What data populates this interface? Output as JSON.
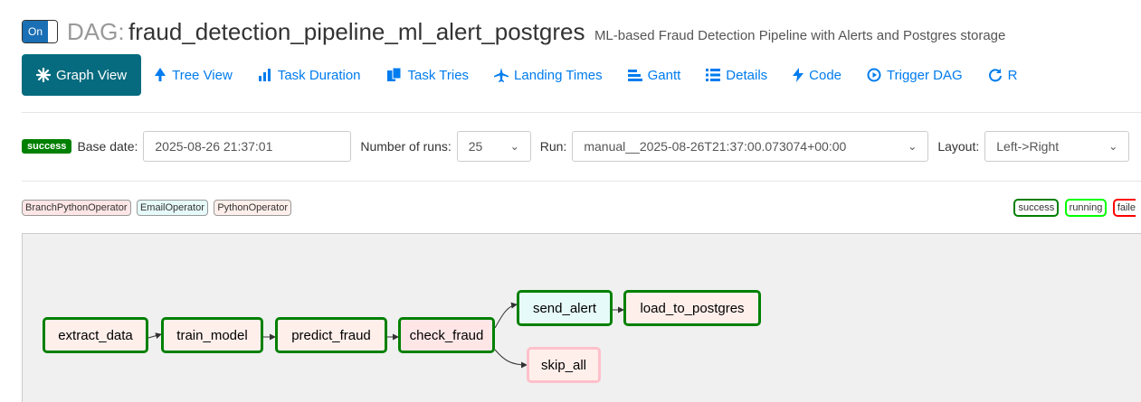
{
  "header": {
    "toggle_label": "On",
    "dag_prefix": "DAG:",
    "dag_id": "fraud_detection_pipeline_ml_alert_postgres",
    "description": "ML-based Fraud Detection Pipeline with Alerts and Postgres storage"
  },
  "nav": [
    {
      "label": "Graph View",
      "icon": "asterisk-icon",
      "active": true
    },
    {
      "label": "Tree View",
      "icon": "tree-icon"
    },
    {
      "label": "Task Duration",
      "icon": "bar-chart-icon"
    },
    {
      "label": "Task Tries",
      "icon": "files-icon"
    },
    {
      "label": "Landing Times",
      "icon": "plane-icon"
    },
    {
      "label": "Gantt",
      "icon": "gantt-icon"
    },
    {
      "label": "Details",
      "icon": "list-icon"
    },
    {
      "label": "Code",
      "icon": "bolt-icon"
    },
    {
      "label": "Trigger DAG",
      "icon": "play-circle-icon"
    },
    {
      "label": "R",
      "icon": "refresh-icon"
    }
  ],
  "form": {
    "state_badge": "success",
    "base_date_label": "Base date:",
    "base_date_value": "2025-08-26 21:37:01",
    "num_runs_label": "Number of runs:",
    "num_runs_value": "25",
    "run_label": "Run:",
    "run_value": "manual__2025-08-26T21:37:00.073074+00:00",
    "layout_label": "Layout:",
    "layout_value": "Left->Right"
  },
  "operators": [
    {
      "name": "BranchPythonOperator",
      "color": "#ffe6e6"
    },
    {
      "name": "EmailOperator",
      "color": "#e6faf9"
    },
    {
      "name": "PythonOperator",
      "color": "#ffefeb"
    }
  ],
  "states": [
    {
      "name": "success",
      "color": "#008000"
    },
    {
      "name": "running",
      "color": "#00ff00"
    },
    {
      "name": "faile",
      "color": "#ff0000"
    }
  ],
  "graph": {
    "nodes": [
      {
        "id": "extract_data",
        "fill": "#ffefeb",
        "border": "#008000"
      },
      {
        "id": "train_model",
        "fill": "#ffefeb",
        "border": "#008000"
      },
      {
        "id": "predict_fraud",
        "fill": "#ffefeb",
        "border": "#008000"
      },
      {
        "id": "check_fraud",
        "fill": "#ffe6e6",
        "border": "#008000"
      },
      {
        "id": "send_alert",
        "fill": "#e6faf9",
        "border": "#008000"
      },
      {
        "id": "load_to_postgres",
        "fill": "#ffefeb",
        "border": "#008000"
      },
      {
        "id": "skip_all",
        "fill": "#ffefeb",
        "border": "#ffc0cb"
      }
    ]
  },
  "colors": {
    "accent": "#017cee",
    "active_tab": "#066b7f",
    "success": "#008000"
  }
}
